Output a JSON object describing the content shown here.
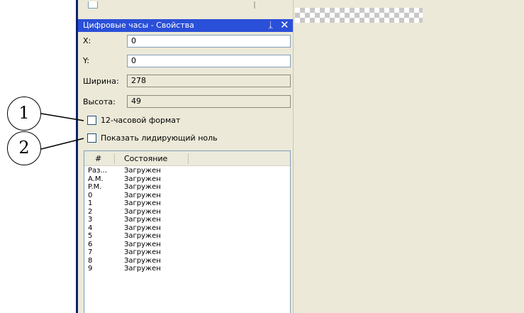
{
  "panel": {
    "title": "Цифровые часы - Свойства",
    "pin_glyph": "ᛣ",
    "close_glyph": "✕",
    "fields": [
      {
        "label": "X:",
        "value": "0",
        "readonly": false
      },
      {
        "label": "Y:",
        "value": "0",
        "readonly": false
      },
      {
        "label": "Ширина:",
        "value": "278",
        "readonly": true
      },
      {
        "label": "Высота:",
        "value": "49",
        "readonly": true
      }
    ],
    "checkboxes": [
      {
        "label": "12-часовой формат",
        "checked": false
      },
      {
        "label": "Показать лидирующий ноль",
        "checked": false
      }
    ],
    "list": {
      "columns": [
        "#",
        "Состояние"
      ],
      "rows": [
        [
          "Раз...",
          "Загружен"
        ],
        [
          "A.M.",
          "Загружен"
        ],
        [
          "P.M.",
          "Загружен"
        ],
        [
          "0",
          "Загружен"
        ],
        [
          "1",
          "Загружен"
        ],
        [
          "2",
          "Загружен"
        ],
        [
          "3",
          "Загружен"
        ],
        [
          "4",
          "Загружен"
        ],
        [
          "5",
          "Загружен"
        ],
        [
          "6",
          "Загружен"
        ],
        [
          "7",
          "Загружен"
        ],
        [
          "8",
          "Загружен"
        ],
        [
          "9",
          "Загружен"
        ]
      ]
    }
  },
  "callouts": [
    "1",
    "2"
  ],
  "colors": {
    "titlebar": "#2a4fd8",
    "panel_bg": "#ece9d8",
    "field_border": "#7f9db9"
  }
}
